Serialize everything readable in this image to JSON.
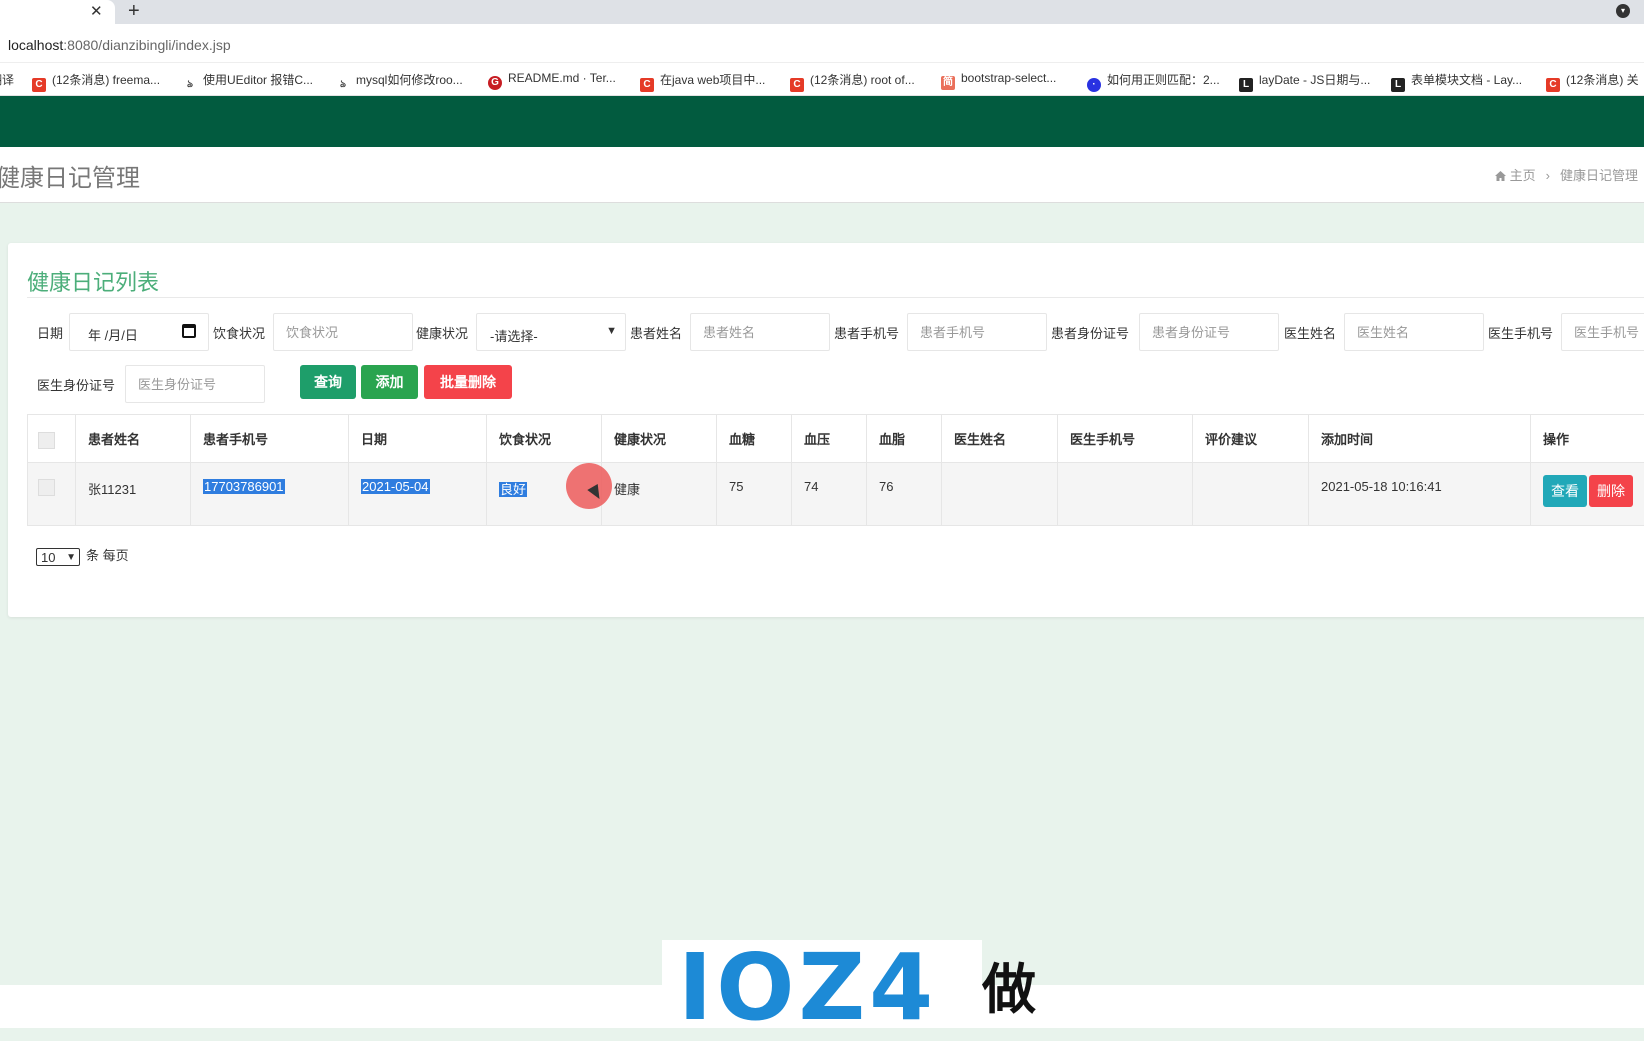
{
  "browser": {
    "url_host": "localhost",
    "url_path": ":8080/dianzibingli/index.jsp",
    "new_tab_label": "+",
    "close_tab_label": "✕",
    "bookmarks": [
      {
        "label": "翻译",
        "icon": "plain"
      },
      {
        "label": "(12条消息) freema...",
        "icon": "csdn"
      },
      {
        "label": "使用UEditor 报错C...",
        "icon": "github"
      },
      {
        "label": "mysql如何修改roo...",
        "icon": "github"
      },
      {
        "label": "README.md · Ter...",
        "icon": "gitee"
      },
      {
        "label": "在java web项目中...",
        "icon": "csdn"
      },
      {
        "label": "(12条消息) root of...",
        "icon": "csdn"
      },
      {
        "label": "bootstrap-select...",
        "icon": "jian"
      },
      {
        "label": "如何用正则匹配：2...",
        "icon": "paw"
      },
      {
        "label": "layDate - JS日期与...",
        "icon": "layui"
      },
      {
        "label": "表单模块文档 - Lay...",
        "icon": "layui"
      },
      {
        "label": "(12条消息) 关",
        "icon": "csdn"
      }
    ]
  },
  "header": {
    "page_title": "健康日记管理",
    "breadcrumb_home": "主页",
    "breadcrumb_current": "健康日记管理",
    "bar_color": "#025b3f"
  },
  "card": {
    "title": "健康日记列表"
  },
  "filters": {
    "date_label": "日期",
    "date_value": "年 /月/日",
    "diet_label": "饮食状况",
    "diet_placeholder": "饮食状况",
    "health_label": "健康状况",
    "health_value": "-请选择-",
    "patient_name_label": "患者姓名",
    "patient_name_placeholder": "患者姓名",
    "patient_phone_label": "患者手机号",
    "patient_phone_placeholder": "患者手机号",
    "patient_id_label": "患者身份证号",
    "patient_id_placeholder": "患者身份证号",
    "doctor_name_label": "医生姓名",
    "doctor_name_placeholder": "医生姓名",
    "doctor_phone_label": "医生手机号",
    "doctor_phone_placeholder": "医生手机号",
    "doctor_id_label": "医生身份证号",
    "doctor_id_placeholder": "医生身份证号"
  },
  "buttons": {
    "query": "查询",
    "add": "添加",
    "batch_delete": "批量删除",
    "view": "查看",
    "delete": "删除"
  },
  "colors": {
    "query": "#1e9e6a",
    "add": "#2aa44f",
    "danger": "#f4434a",
    "view": "#21a8b8",
    "title_green": "#4cae7a"
  },
  "table": {
    "columns": [
      "患者姓名",
      "患者手机号",
      "日期",
      "饮食状况",
      "健康状况",
      "血糖",
      "血压",
      "血脂",
      "医生姓名",
      "医生手机号",
      "评价建议",
      "添加时间",
      "操作"
    ],
    "rows": [
      {
        "patient_name": "张11231",
        "patient_phone": "17703786901",
        "date": "2021-05-04",
        "diet": "良好",
        "health": "健康",
        "blood_sugar": "75",
        "blood_pressure": "74",
        "blood_lipid": "76",
        "doctor_name": "",
        "doctor_phone": "",
        "evaluation": "",
        "added_time": "2021-05-18 10:16:41"
      }
    ]
  },
  "pager": {
    "page_size": "10",
    "suffix": "条 每页"
  },
  "watermark": {
    "text": "IOZ4",
    "tail": "做"
  }
}
